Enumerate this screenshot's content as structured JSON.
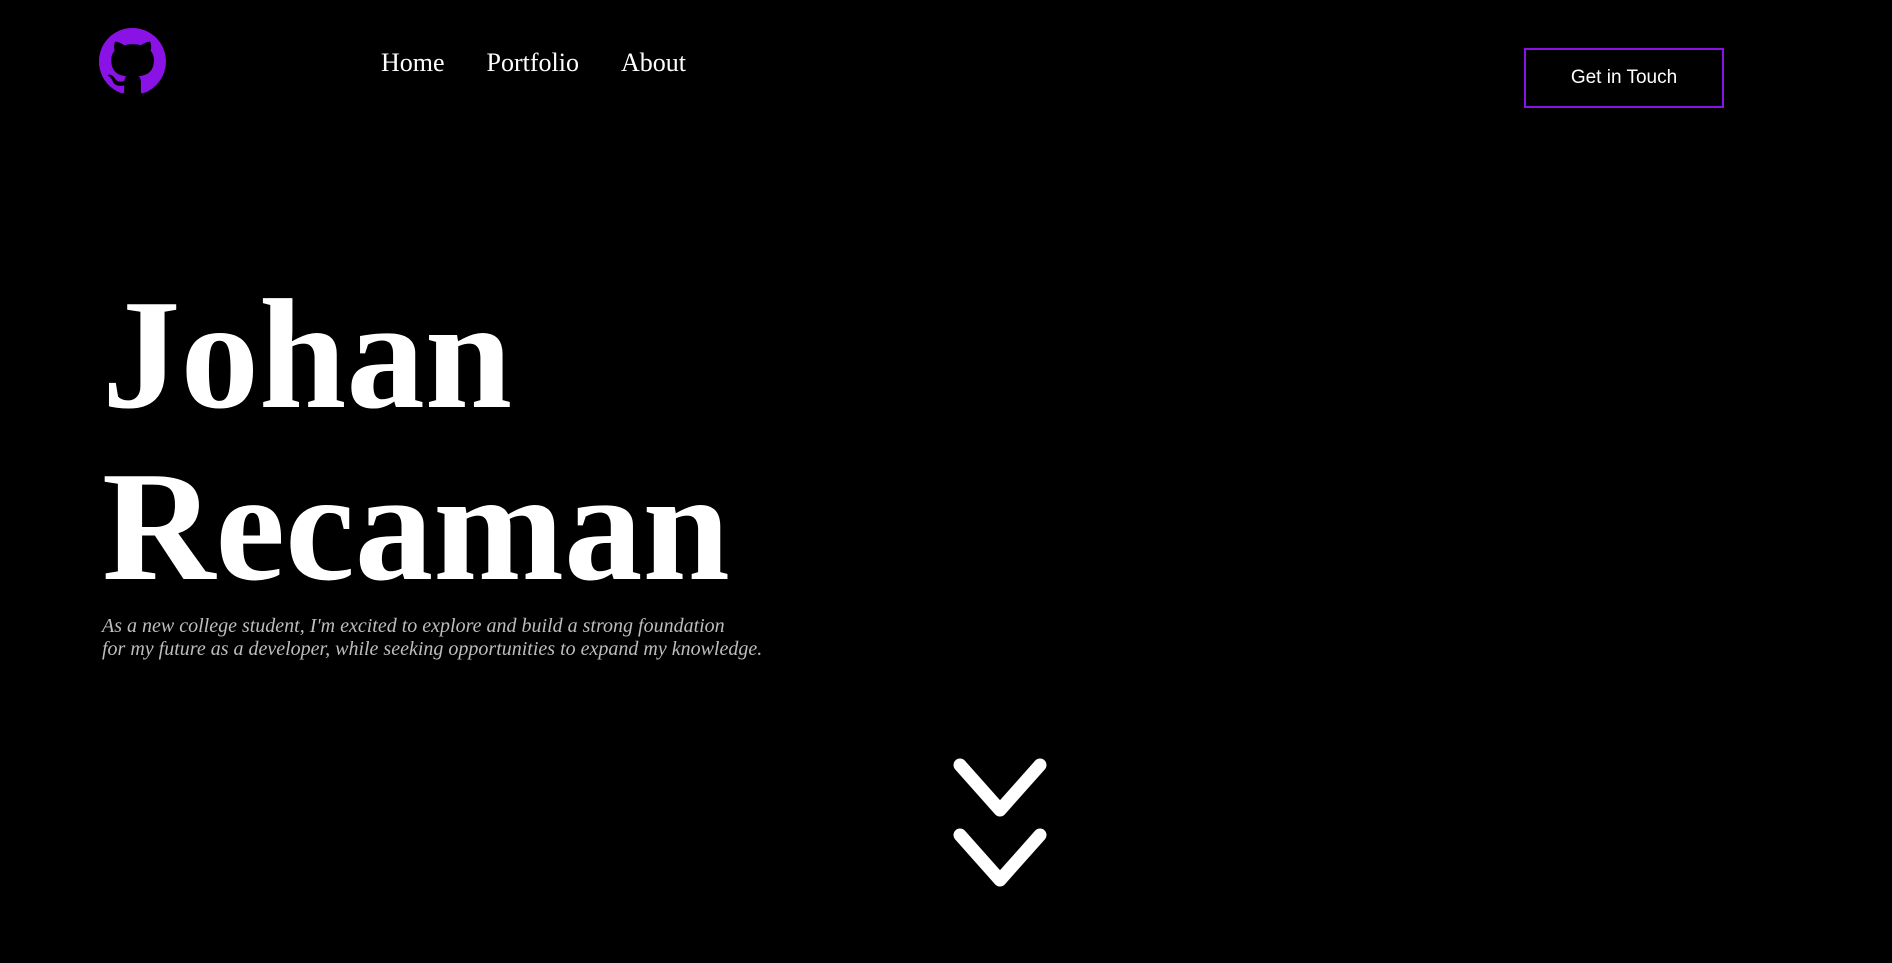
{
  "header": {
    "logo_icon": "github-icon",
    "logo_color": "#8a12e6",
    "nav": [
      {
        "label": "Home"
      },
      {
        "label": "Portfolio"
      },
      {
        "label": "About"
      }
    ],
    "cta_label": "Get in Touch",
    "cta_border_color": "#8a12e6"
  },
  "hero": {
    "name_line1": "Johan",
    "name_line2": "Recaman",
    "tagline_line1": "As a new college student, I'm excited to explore and build a strong foundation",
    "tagline_line2": "for my future as a developer, while seeking opportunities to expand my knowledge."
  },
  "scroll_indicator": {
    "icon": "double-chevron-down-icon",
    "color": "#ffffff"
  }
}
